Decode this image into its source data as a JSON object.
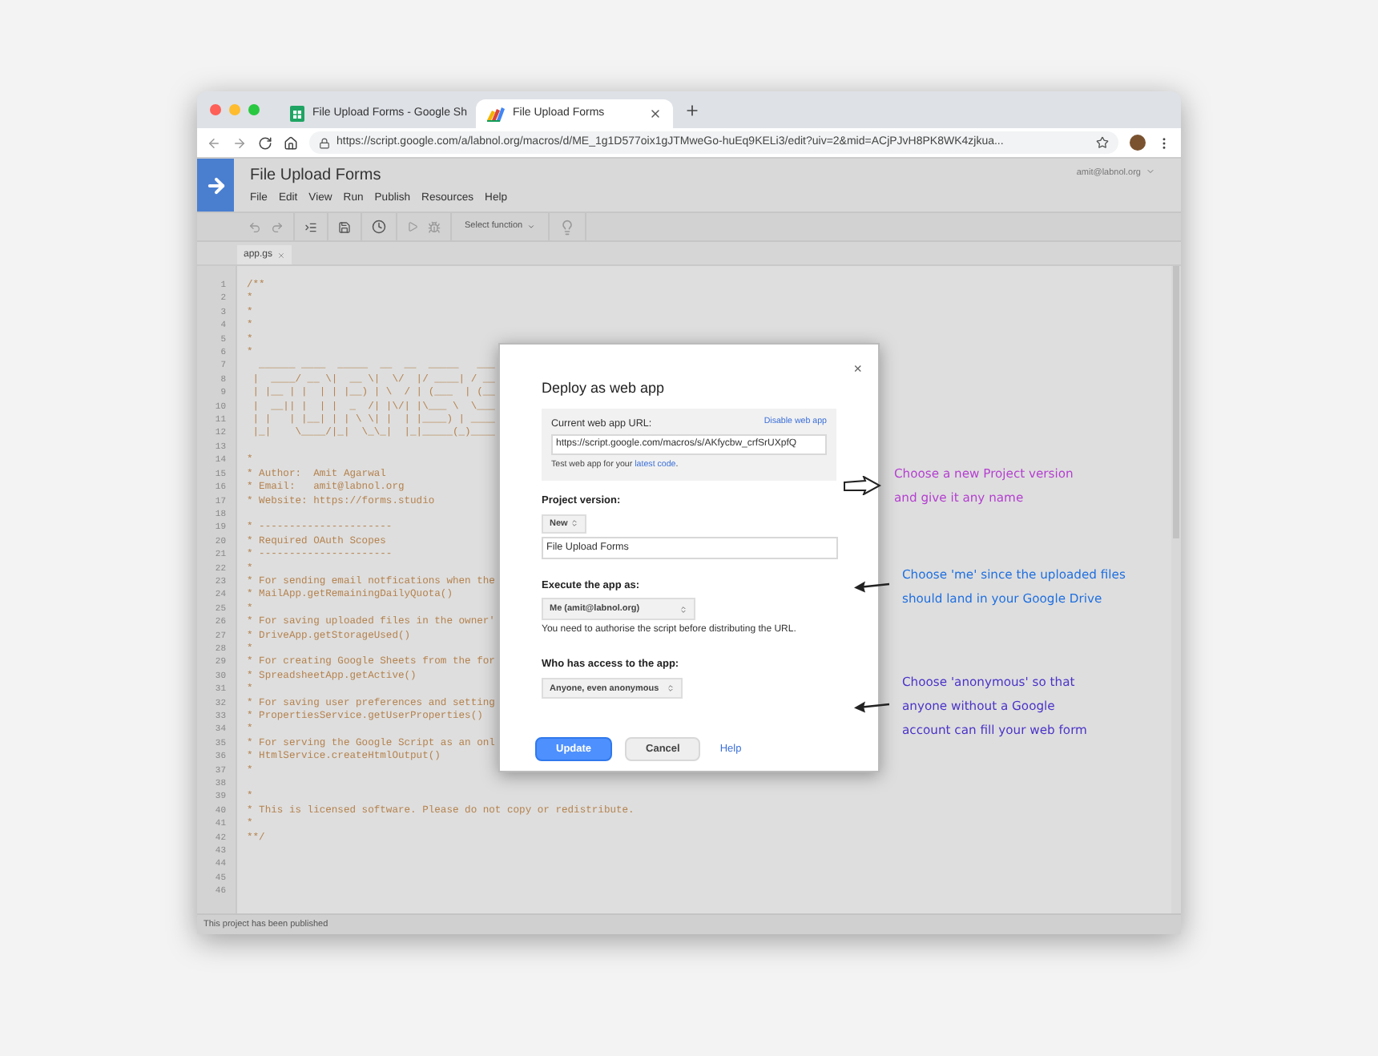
{
  "browser": {
    "tabs": [
      {
        "title": "File Upload Forms - Google Sh",
        "kind": "sheets",
        "selected": false
      },
      {
        "title": "File Upload Forms",
        "kind": "script",
        "selected": true
      }
    ],
    "url": "https://script.google.com/a/labnol.org/macros/d/ME_1g1D577oix1gJTMweGo-huEq9KELi3/edit?uiv=2&mid=ACjPJvH8PK8WK4zjkua..."
  },
  "app": {
    "title": "File Upload Forms",
    "menu": [
      "File",
      "Edit",
      "View",
      "Run",
      "Publish",
      "Resources",
      "Help"
    ],
    "user": "amit@labnol.org",
    "function_select": "Select function"
  },
  "file_tabs": [
    {
      "name": "app.gs",
      "selected": true
    }
  ],
  "code": [
    {
      "n": "1",
      "text": "/**"
    },
    {
      "n": "2",
      "text": "*"
    },
    {
      "n": "3",
      "text": "*"
    },
    {
      "n": "4",
      "text": "*"
    },
    {
      "n": "5",
      "text": "*"
    },
    {
      "n": "6",
      "text": "*"
    },
    {
      "n": "7",
      "text": "  ______ ____  _____  __  __  _____   ___"
    },
    {
      "n": "8",
      "text": " |  ____/ __ \\|  __ \\|  \\/  |/ ____| / __"
    },
    {
      "n": "9",
      "text": " | |__ | |  | | |__) | \\  / | (___  | (__"
    },
    {
      "n": "10",
      "text": " |  __|| |  | |  _  /| |\\/| |\\___ \\  \\___"
    },
    {
      "n": "11",
      "text": " | |   | |__| | | \\ \\| |  | |____) | ____"
    },
    {
      "n": "12",
      "text": " |_|    \\____/|_|  \\_\\_|  |_|_____(_)____"
    },
    {
      "n": "13"
    },
    {
      "n": "14",
      "text": "*"
    },
    {
      "n": "15",
      "text": "* Author:  Amit Agarwal"
    },
    {
      "n": "16",
      "text": "* Email:   amit@labnol.org"
    },
    {
      "n": "17",
      "text": "* Website: https://forms.studio"
    },
    {
      "n": "18"
    },
    {
      "n": "19",
      "text": "* ----------------------"
    },
    {
      "n": "20",
      "text": "* Required OAuth Scopes"
    },
    {
      "n": "21",
      "text": "* ----------------------"
    },
    {
      "n": "22",
      "text": "*"
    },
    {
      "n": "23",
      "text": "* For sending email notfications when the"
    },
    {
      "n": "24",
      "text": "* MailApp.getRemainingDailyQuota()"
    },
    {
      "n": "25",
      "text": "*"
    },
    {
      "n": "26",
      "text": "* For saving uploaded files in the owner'"
    },
    {
      "n": "27",
      "text": "* DriveApp.getStorageUsed()"
    },
    {
      "n": "28",
      "text": "*"
    },
    {
      "n": "29",
      "text": "* For creating Google Sheets from the for"
    },
    {
      "n": "30",
      "text": "* SpreadsheetApp.getActive()"
    },
    {
      "n": "31",
      "text": "*"
    },
    {
      "n": "32",
      "text": "* For saving user preferences and setting"
    },
    {
      "n": "33",
      "text": "* PropertiesService.getUserProperties()"
    },
    {
      "n": "34",
      "text": "*"
    },
    {
      "n": "35",
      "text": "* For serving the Google Script as an onl"
    },
    {
      "n": "36",
      "text": "* HtmlService.createHtmlOutput()"
    },
    {
      "n": "37",
      "text": "*"
    },
    {
      "n": "38"
    },
    {
      "n": "39",
      "text": "*"
    },
    {
      "n": "40",
      "text": "* This is licensed software. Please do not copy or redistribute."
    },
    {
      "n": "41",
      "text": "*"
    },
    {
      "n": "42",
      "text": "**/"
    },
    {
      "n": "43"
    },
    {
      "n": "44"
    },
    {
      "n": "45"
    },
    {
      "n": "46"
    }
  ],
  "status_bar": "This project has been published",
  "dialog": {
    "title": "Deploy as web app",
    "close": "×",
    "url_label": "Current web app URL:",
    "disable_link": "Disable web app",
    "url_value": "https://script.google.com/macros/s/AKfycbw_crfSrUXpfQ",
    "note_before": "Test web app for your ",
    "note_link": "latest code",
    "note_after": ".",
    "version_label": "Project version:",
    "version_select": "New",
    "version_name": "File Upload Forms",
    "execute_label": "Execute the app as:",
    "execute_select": "Me (amit@labnol.org)",
    "execute_note": "You need to authorise the script before distributing the URL.",
    "access_label": "Who has access to the app:",
    "access_select": "Anyone, even anonymous",
    "buttons": [
      {
        "label": "Update",
        "kind": "primary"
      },
      {
        "label": "Cancel",
        "kind": "secondary"
      },
      {
        "label": "Help",
        "kind": "link"
      }
    ]
  },
  "annotations": [
    {
      "lines": [
        "Choose a new Project version",
        "and give it any name"
      ],
      "color": "#b43fd0",
      "kind": "hollow"
    },
    {
      "lines": [
        "Choose 'me' since the uploaded files",
        "should land in your Google Drive"
      ],
      "color": "#1f6fe0",
      "kind": "solid"
    },
    {
      "lines": [
        "Choose 'anonymous' so that",
        "anyone without a Google",
        "account can fill your web form"
      ],
      "color": "#4a33c8",
      "kind": "solid"
    }
  ]
}
